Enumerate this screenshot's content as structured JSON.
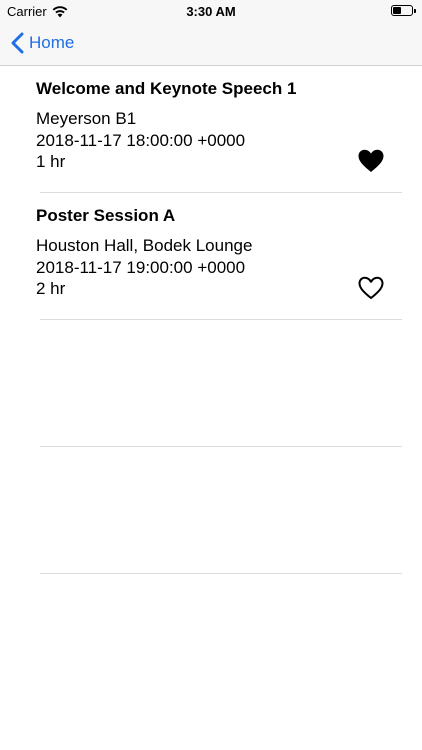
{
  "status_bar": {
    "carrier": "Carrier",
    "time": "3:30 AM",
    "battery_level": 0.45
  },
  "nav": {
    "back_label": "Home"
  },
  "sessions": [
    {
      "title": "Welcome and Keynote Speech 1",
      "location": "Meyerson B1",
      "datetime": "2018-11-17 18:00:00 +0000",
      "duration": "1 hr",
      "favorited": true
    },
    {
      "title": "Poster Session A",
      "location": "Houston Hall, Bodek Lounge",
      "datetime": "2018-11-17 19:00:00 +0000",
      "duration": "2 hr",
      "favorited": false
    }
  ],
  "empty_rows": 2,
  "colors": {
    "accent": "#1f6fe6",
    "bar_background": "#f7f7f7",
    "separator": "#dcdcdc"
  },
  "icons": {
    "back": "chevron-left-icon",
    "wifi": "wifi-icon",
    "battery": "battery-icon",
    "favorite_filled": "heart-filled-icon",
    "favorite_outline": "heart-outline-icon"
  }
}
